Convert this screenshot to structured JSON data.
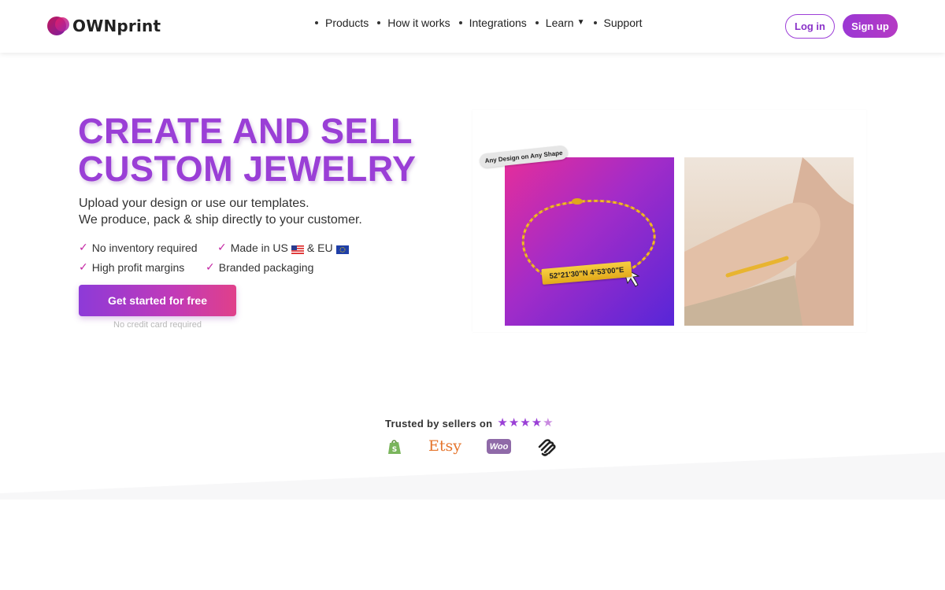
{
  "brand": {
    "name": "OWNprint",
    "colors": {
      "accent": "#9a3fd6",
      "pink": "#c426a4"
    }
  },
  "nav": {
    "items": [
      {
        "label": "Products"
      },
      {
        "label": "How it works"
      },
      {
        "label": "Integrations"
      },
      {
        "label": "Learn",
        "caret": "▼"
      },
      {
        "label": "Support"
      }
    ]
  },
  "auth": {
    "login_label": "Log in",
    "signup_label": "Sign up"
  },
  "hero": {
    "title_line1": "CREATE AND SELL",
    "title_line2": "CUSTOM JEWELRY",
    "subtitle_line1": "Upload your design or use our templates.",
    "subtitle_line2": "We produce, pack & ship directly to your customer.",
    "features": {
      "no_inventory": "No inventory required",
      "made_in_prefix": "Made in US",
      "made_in_mid": "& EU",
      "profit": "High profit margins",
      "packaging": "Branded packaging"
    },
    "cta_label": "Get started for free",
    "cta_note": "No credit card required"
  },
  "media": {
    "badge": "Any Design on Any Shape",
    "coordinates": "52°21'30\"N 4°53'00\"E"
  },
  "trust": {
    "label": "Trusted by sellers on",
    "rating": 4.5,
    "rating_max": 5,
    "platforms": {
      "shopify_icon": "shopify-icon",
      "etsy": "Etsy",
      "woo": "Woo",
      "squarespace_icon": "squarespace-icon"
    }
  }
}
